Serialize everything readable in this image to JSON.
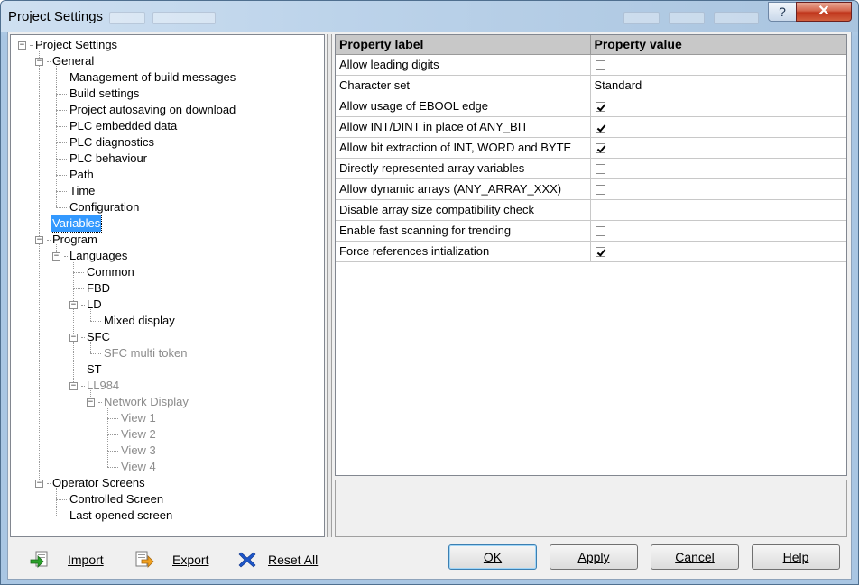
{
  "window": {
    "title": "Project Settings",
    "help_glyph": "?",
    "close_glyph": "✕"
  },
  "tree": {
    "nodes": [
      {
        "label": "Project Settings",
        "toggle": "−",
        "disabled": false
      },
      {
        "label": "General",
        "toggle": "−",
        "disabled": false
      },
      {
        "label": "Management of build messages",
        "disabled": false
      },
      {
        "label": "Build settings",
        "disabled": false
      },
      {
        "label": "Project autosaving on download",
        "disabled": false
      },
      {
        "label": "PLC embedded data",
        "disabled": false
      },
      {
        "label": "PLC diagnostics",
        "disabled": false
      },
      {
        "label": "PLC behaviour",
        "disabled": false
      },
      {
        "label": "Path",
        "disabled": false
      },
      {
        "label": "Time",
        "disabled": false
      },
      {
        "label": "Configuration",
        "disabled": false
      },
      {
        "label": "Variables",
        "disabled": false,
        "selected": true
      },
      {
        "label": "Program",
        "toggle": "−",
        "disabled": false
      },
      {
        "label": "Languages",
        "toggle": "−",
        "disabled": false
      },
      {
        "label": "Common",
        "disabled": false
      },
      {
        "label": "FBD",
        "disabled": false
      },
      {
        "label": "LD",
        "toggle": "−",
        "disabled": false
      },
      {
        "label": "Mixed display",
        "disabled": false
      },
      {
        "label": "SFC",
        "toggle": "−",
        "disabled": false
      },
      {
        "label": "SFC multi token",
        "disabled": true
      },
      {
        "label": "ST",
        "disabled": false
      },
      {
        "label": "LL984",
        "toggle": "−",
        "disabled": true
      },
      {
        "label": "Network Display",
        "toggle": "−",
        "disabled": true
      },
      {
        "label": "View 1",
        "disabled": true
      },
      {
        "label": "View 2",
        "disabled": true
      },
      {
        "label": "View 3",
        "disabled": true
      },
      {
        "label": "View 4",
        "disabled": true
      },
      {
        "label": "Operator Screens",
        "toggle": "−",
        "disabled": false
      },
      {
        "label": "Controlled Screen",
        "disabled": false
      },
      {
        "label": "Last opened screen",
        "disabled": false
      }
    ]
  },
  "grid": {
    "headers": [
      "Property label",
      "Property value"
    ],
    "rows": [
      {
        "label": "Allow leading digits",
        "type": "checkbox",
        "checked": false
      },
      {
        "label": "Character set",
        "type": "text",
        "value": "Standard"
      },
      {
        "label": "Allow usage of EBOOL edge",
        "type": "checkbox",
        "checked": true
      },
      {
        "label": "Allow INT/DINT in place of ANY_BIT",
        "type": "checkbox",
        "checked": true
      },
      {
        "label": "Allow bit extraction of INT, WORD and BYTE",
        "type": "checkbox",
        "checked": true
      },
      {
        "label": "Directly represented array variables",
        "type": "checkbox",
        "checked": false
      },
      {
        "label": "Allow dynamic arrays (ANY_ARRAY_XXX)",
        "type": "checkbox",
        "checked": false
      },
      {
        "label": "Disable array size compatibility check",
        "type": "checkbox",
        "checked": false
      },
      {
        "label": "Enable fast scanning for trending",
        "type": "checkbox",
        "checked": false
      },
      {
        "label": "Force references intialization",
        "type": "checkbox",
        "checked": true
      }
    ]
  },
  "toolbar": {
    "import_label": "Import",
    "export_label": "Export",
    "reset_label": "Reset All"
  },
  "buttons": {
    "ok": "OK",
    "apply": "Apply",
    "cancel": "Cancel",
    "help": "Help"
  },
  "colors": {
    "selection": "#3399ff",
    "header_bg": "#c8c8c8",
    "close": "#c0361c"
  }
}
